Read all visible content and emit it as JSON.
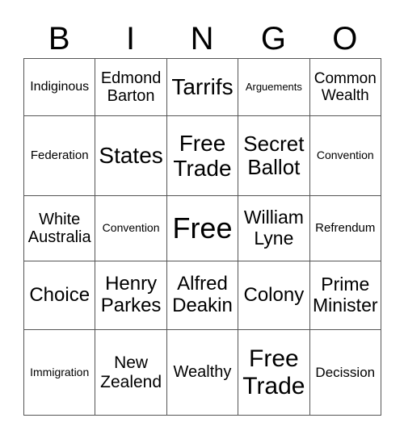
{
  "header": [
    "B",
    "I",
    "N",
    "G",
    "O"
  ],
  "grid": [
    [
      "Indiginous",
      "Edmond Barton",
      "Tarrifs",
      "Arguements",
      "Common Wealth"
    ],
    [
      "Federation",
      "States",
      "Free Trade",
      "Secret Ballot",
      "Convention"
    ],
    [
      "White Australia",
      "Convention",
      "Free",
      "William Lyne",
      "Refrendum"
    ],
    [
      "Choice",
      "Henry Parkes",
      "Alfred Deakin",
      "Colony",
      "Prime Minister"
    ],
    [
      "Immigration",
      "New Zealend",
      "Wealthy",
      "Free Trade",
      "Decission"
    ]
  ]
}
